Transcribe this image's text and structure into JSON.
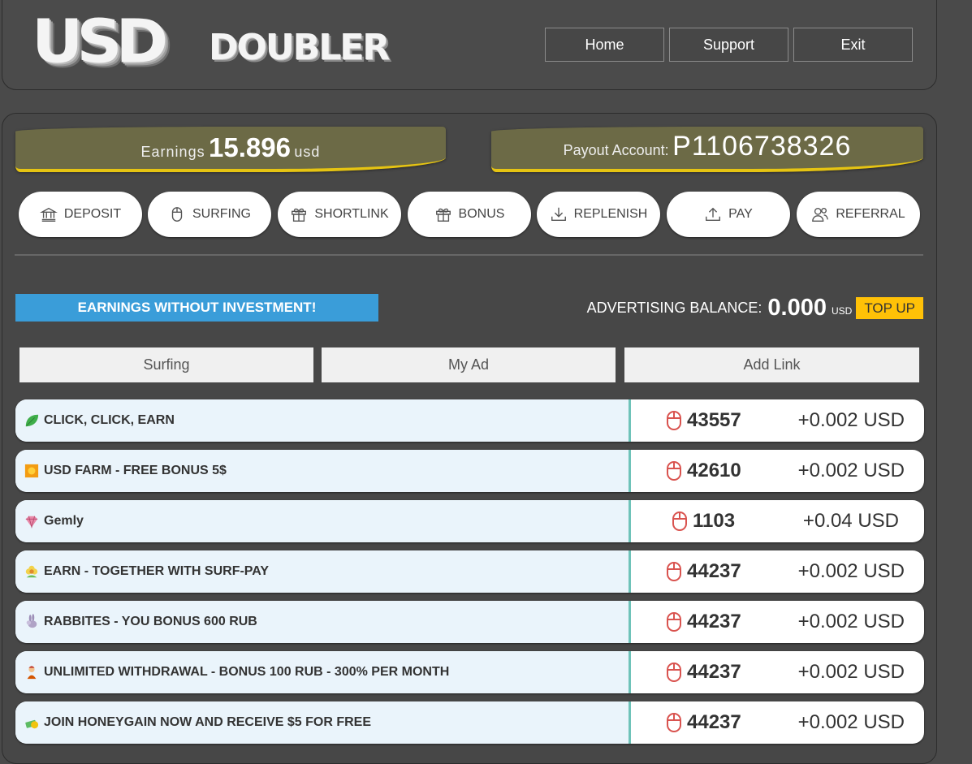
{
  "header": {
    "logo_big": "USD",
    "logo_small": "DOUBLER",
    "nav": [
      "Home",
      "Support",
      "Exit"
    ]
  },
  "stats": {
    "earnings_label": "Earnings",
    "earnings_value": "15.896",
    "earnings_unit": "usd",
    "payout_label": "Payout Account:",
    "payout_value": "P1106738326"
  },
  "menu": [
    {
      "label": "DEPOSIT",
      "icon": "bank-icon"
    },
    {
      "label": "SURFING",
      "icon": "mouse-icon"
    },
    {
      "label": "SHORTLINK",
      "icon": "gift-icon"
    },
    {
      "label": "BONUS",
      "icon": "gift-icon"
    },
    {
      "label": "REPLENISH",
      "icon": "download-icon"
    },
    {
      "label": "PAY",
      "icon": "upload-icon"
    },
    {
      "label": "REFERRAL",
      "icon": "users-icon"
    }
  ],
  "promo": {
    "banner": "EARNINGS WITHOUT INVESTMENT!",
    "adv_label": "ADVERTISING BALANCE:",
    "adv_value": "0.000",
    "adv_unit": "USD",
    "topup": "TOP UP"
  },
  "tabs": [
    "Surfing",
    "My Ad",
    "Add Link"
  ],
  "colors": {
    "accent_blue": "#3a9dd9",
    "ribbon_gold": "#e6c412",
    "topup_yellow": "#ffc107",
    "mouse_red": "#d9534f",
    "row_divider": "#6fc3b9"
  },
  "ads": [
    {
      "icon": "leaf-icon",
      "title": "CLICK, CLICK, EARN",
      "count": "43557",
      "reward": "+0.002 USD"
    },
    {
      "icon": "orange-square-icon",
      "title": "USD FARM - FREE BONUS 5$",
      "count": "42610",
      "reward": "+0.002 USD"
    },
    {
      "icon": "gem-icon",
      "title": "Gemly",
      "count": "1103",
      "reward": "+0.04 USD"
    },
    {
      "icon": "flower-icon",
      "title": "EARN - TOGETHER WITH SURF-PAY",
      "count": "44237",
      "reward": "+0.002 USD"
    },
    {
      "icon": "rabbit-icon",
      "title": "RABBITES - YOU BONUS 600 RUB",
      "count": "44237",
      "reward": "+0.002 USD"
    },
    {
      "icon": "person-icon",
      "title": "UNLIMITED WITHDRAWAL - BONUS 100 RUB - 300% PER MONTH",
      "count": "44237",
      "reward": "+0.002 USD"
    },
    {
      "icon": "money-icon",
      "title": "JOIN HONEYGAIN NOW AND RECEIVE $5 FOR FREE",
      "count": "44237",
      "reward": "+0.002 USD"
    }
  ]
}
